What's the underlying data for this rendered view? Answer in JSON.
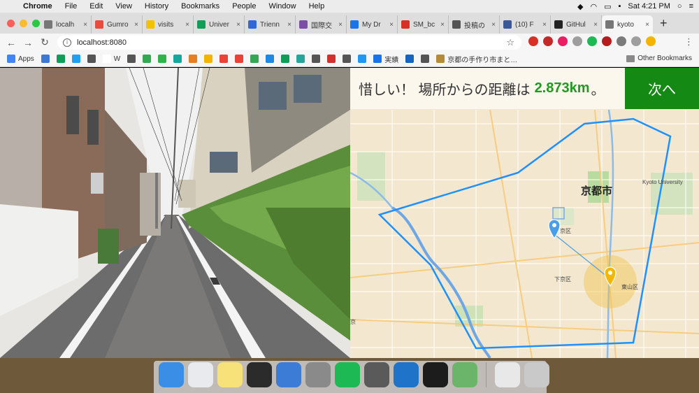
{
  "menubar": {
    "app": "Chrome",
    "items": [
      "File",
      "Edit",
      "View",
      "History",
      "Bookmarks",
      "People",
      "Window",
      "Help"
    ],
    "clock": "Sat 4:21 PM"
  },
  "tabs": [
    {
      "label": "localh",
      "color": "#777"
    },
    {
      "label": "Gumro",
      "color": "#e94b3c"
    },
    {
      "label": "visits",
      "color": "#f2c200"
    },
    {
      "label": "Univer",
      "color": "#0f9d58"
    },
    {
      "label": "Trienn",
      "color": "#3367d6"
    },
    {
      "label": "国際交",
      "color": "#7b4fa8"
    },
    {
      "label": "My Dr",
      "color": "#1a73e8"
    },
    {
      "label": "SM_bc",
      "color": "#d93025"
    },
    {
      "label": "投稿の",
      "color": "#555"
    },
    {
      "label": "(10) F",
      "color": "#3b5998"
    },
    {
      "label": "GitHul",
      "color": "#222"
    },
    {
      "label": "kyoto",
      "color": "#777",
      "active": true
    }
  ],
  "toolbar": {
    "url": "localhost:8080"
  },
  "bookmarks": {
    "items": [
      {
        "label": "Apps",
        "color": "#4285f4"
      },
      {
        "label": "",
        "color": "#3c78d8"
      },
      {
        "label": "",
        "color": "#0f9d58"
      },
      {
        "label": "",
        "color": "#1da1f2"
      },
      {
        "label": "",
        "color": "#555"
      },
      {
        "label": "W",
        "color": "#fff"
      },
      {
        "label": "",
        "color": "#555"
      },
      {
        "label": "",
        "color": "#34a853"
      },
      {
        "label": "",
        "color": "#2fb34a"
      },
      {
        "label": "",
        "color": "#12a89d"
      },
      {
        "label": "",
        "color": "#e67e22"
      },
      {
        "label": "",
        "color": "#f4b400"
      },
      {
        "label": "",
        "color": "#ea4335"
      },
      {
        "label": "",
        "color": "#ea4335"
      },
      {
        "label": "",
        "color": "#34a853"
      },
      {
        "label": "",
        "color": "#1e88e5"
      },
      {
        "label": "",
        "color": "#0f9d58"
      },
      {
        "label": "",
        "color": "#26a69a"
      },
      {
        "label": "",
        "color": "#555"
      },
      {
        "label": "",
        "color": "#d32f2f"
      },
      {
        "label": "",
        "color": "#555"
      },
      {
        "label": "",
        "color": "#2196f3"
      },
      {
        "label": "実績",
        "color": "#1a73e8"
      },
      {
        "label": "",
        "color": "#1565c0"
      },
      {
        "label": "",
        "color": "#555"
      },
      {
        "label": "京都の手作り市まと…",
        "color": "#b58b3a"
      }
    ],
    "other": "Other Bookmarks"
  },
  "game": {
    "message_prefix": "惜しい！ 場所からの距離は",
    "distance": "2.873km",
    "message_suffix": "。",
    "next_label": "次へ"
  },
  "map": {
    "city_label": "京都市",
    "university_label": "Kyoto University",
    "ward_labels": [
      "下京区",
      "東山区",
      "京区",
      "京"
    ],
    "boundary_color": "#1e90ff",
    "guess_marker_color": "#4a9ee8",
    "answer_marker_color": "#f2b705"
  },
  "dock": {
    "apps": [
      {
        "name": "finder",
        "color": "#3a8ee6"
      },
      {
        "name": "chrome",
        "color": "#e8eaed"
      },
      {
        "name": "notes",
        "color": "#f7e27a"
      },
      {
        "name": "sublime",
        "color": "#2b2b2b"
      },
      {
        "name": "keynote",
        "color": "#3c7bd6"
      },
      {
        "name": "system-preferences",
        "color": "#8a8a8a"
      },
      {
        "name": "spotify",
        "color": "#1db954"
      },
      {
        "name": "calculator",
        "color": "#5a5a5a"
      },
      {
        "name": "vscode",
        "color": "#1f74c9"
      },
      {
        "name": "terminal",
        "color": "#1c1c1c"
      },
      {
        "name": "preview",
        "color": "#6ab56a"
      }
    ],
    "trash_items": [
      {
        "name": "music",
        "color": "#e8e8e8"
      },
      {
        "name": "trash",
        "color": "#c9c9c9"
      }
    ]
  }
}
